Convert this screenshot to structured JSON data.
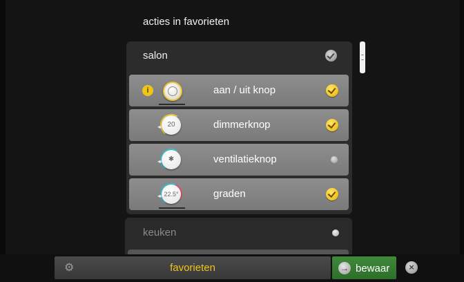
{
  "heading": "acties in favorieten",
  "rooms": [
    {
      "name": "salon",
      "items": [
        {
          "label": "aan / uit knop",
          "knob_text": "",
          "info": "i",
          "selected": true
        },
        {
          "label": "dimmerknop",
          "knob_text": "20",
          "selected": true
        },
        {
          "label": "ventilatieknop",
          "knob_text": "✱",
          "selected": false
        },
        {
          "label": "graden",
          "knob_text": "22.5°",
          "selected": true
        }
      ]
    },
    {
      "name": "keuken",
      "items": []
    }
  ],
  "bottom": {
    "favorites_label": "favorieten",
    "save_label": "bewaar",
    "close_symbol": "×",
    "save_symbol": "→",
    "gear_symbol": "⚙"
  },
  "colors": {
    "accent": "#f0c419",
    "save_green": "#3f8a3a",
    "row_bg": "#858585",
    "panel_bg": "#2c2c2c"
  },
  "icons": {
    "check": "check-circle-icon",
    "info": "info-icon",
    "gear": "gear-icon",
    "close": "close-icon",
    "arrow": "arrow-right-icon"
  }
}
